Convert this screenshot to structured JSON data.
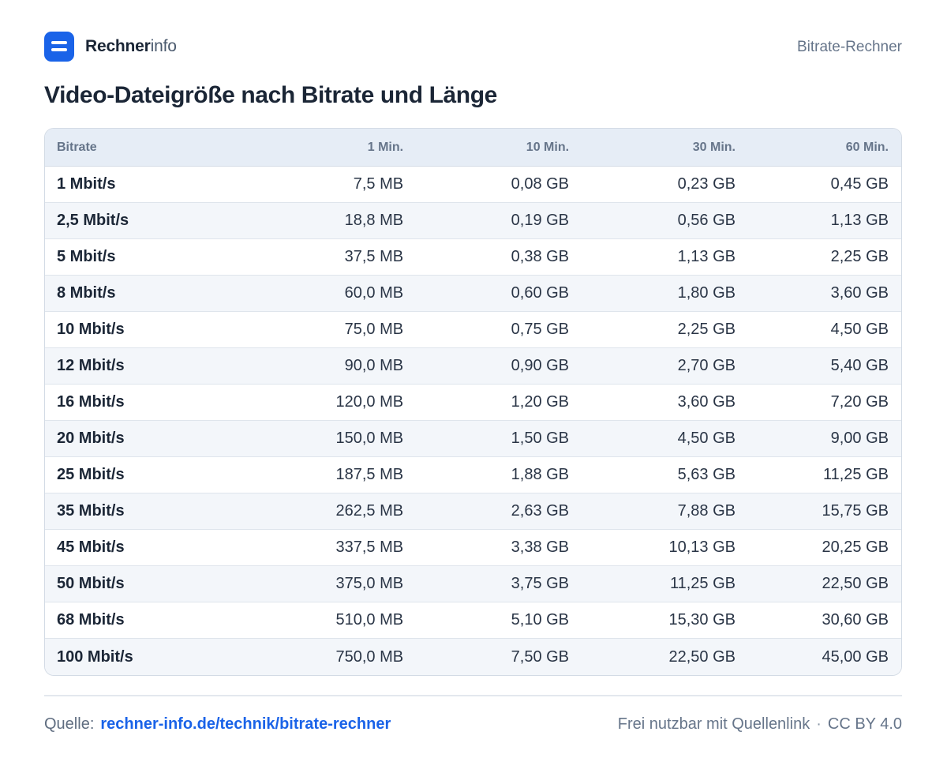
{
  "brand": {
    "name_strong": "Rechner",
    "name_light": "info",
    "icon": "equals-logo-icon"
  },
  "header": {
    "right_text": "Bitrate-Rechner"
  },
  "title": "Video-Dateigröße nach Bitrate und Länge",
  "table": {
    "headers": [
      "Bitrate",
      "1 Min.",
      "10 Min.",
      "30 Min.",
      "60 Min."
    ],
    "rows": [
      [
        "1 Mbit/s",
        "7,5 MB",
        "0,08 GB",
        "0,23 GB",
        "0,45 GB"
      ],
      [
        "2,5 Mbit/s",
        "18,8 MB",
        "0,19 GB",
        "0,56 GB",
        "1,13 GB"
      ],
      [
        "5 Mbit/s",
        "37,5 MB",
        "0,38 GB",
        "1,13 GB",
        "2,25 GB"
      ],
      [
        "8 Mbit/s",
        "60,0 MB",
        "0,60 GB",
        "1,80 GB",
        "3,60 GB"
      ],
      [
        "10 Mbit/s",
        "75,0 MB",
        "0,75 GB",
        "2,25 GB",
        "4,50 GB"
      ],
      [
        "12 Mbit/s",
        "90,0 MB",
        "0,90 GB",
        "2,70 GB",
        "5,40 GB"
      ],
      [
        "16 Mbit/s",
        "120,0 MB",
        "1,20 GB",
        "3,60 GB",
        "7,20 GB"
      ],
      [
        "20 Mbit/s",
        "150,0 MB",
        "1,50 GB",
        "4,50 GB",
        "9,00 GB"
      ],
      [
        "25 Mbit/s",
        "187,5 MB",
        "1,88 GB",
        "5,63 GB",
        "11,25 GB"
      ],
      [
        "35 Mbit/s",
        "262,5 MB",
        "2,63 GB",
        "7,88 GB",
        "15,75 GB"
      ],
      [
        "45 Mbit/s",
        "337,5 MB",
        "3,38 GB",
        "10,13 GB",
        "20,25 GB"
      ],
      [
        "50 Mbit/s",
        "375,0 MB",
        "3,75 GB",
        "11,25 GB",
        "22,50 GB"
      ],
      [
        "68 Mbit/s",
        "510,0 MB",
        "5,10 GB",
        "15,30 GB",
        "30,60 GB"
      ],
      [
        "100 Mbit/s",
        "750,0 MB",
        "7,50 GB",
        "22,50 GB",
        "45,00 GB"
      ]
    ]
  },
  "footer": {
    "source_label": "Quelle:",
    "source_link": "rechner-info.de/technik/bitrate-rechner",
    "license_note": "Frei nutzbar mit Quellenlink",
    "separator": "·",
    "license": "CC BY 4.0"
  },
  "colors": {
    "accent": "#1a63e8",
    "header_bg": "#e6edf6",
    "stripe": "#f3f6fa",
    "text": "#1b2636"
  }
}
